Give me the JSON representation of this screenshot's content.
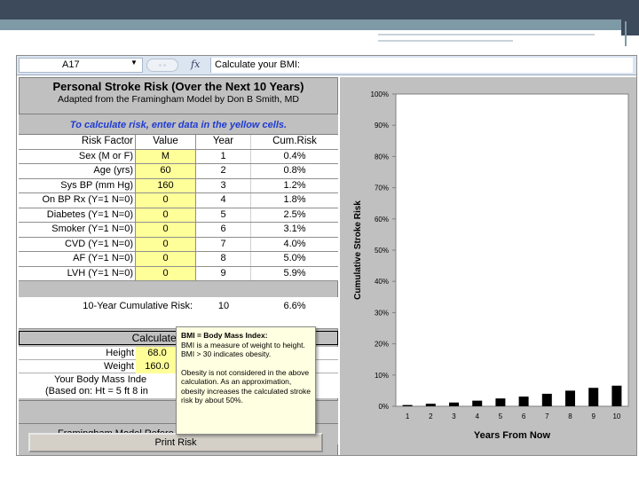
{
  "formula_bar": {
    "cell_ref": "A17",
    "formula": "Calculate your BMI:"
  },
  "sheet": {
    "title": "Personal Stroke Risk (Over the Next 10 Years)",
    "subtitle": "Adapted from the Framingham Model by Don B Smith, MD",
    "instruction": "To calculate risk, enter data in the yellow cells.",
    "columns": [
      "Risk Factor",
      "Value",
      "Year",
      "Cum.Risk"
    ],
    "rows": [
      {
        "factor": "Sex (M or F)",
        "value": "M",
        "year": "1",
        "risk": "0.4%"
      },
      {
        "factor": "Age (yrs)",
        "value": "60",
        "year": "2",
        "risk": "0.8%"
      },
      {
        "factor": "Sys BP (mm Hg)",
        "value": "160",
        "year": "3",
        "risk": "1.2%"
      },
      {
        "factor": "On BP Rx (Y=1 N=0)",
        "value": "0",
        "year": "4",
        "risk": "1.8%"
      },
      {
        "factor": "Diabetes (Y=1 N=0)",
        "value": "0",
        "year": "5",
        "risk": "2.5%"
      },
      {
        "factor": "Smoker (Y=1 N=0)",
        "value": "0",
        "year": "6",
        "risk": "3.1%"
      },
      {
        "factor": "CVD (Y=1 N=0)",
        "value": "0",
        "year": "7",
        "risk": "4.0%"
      },
      {
        "factor": "AF (Y=1 N=0)",
        "value": "0",
        "year": "8",
        "risk": "5.0%"
      },
      {
        "factor": "LVH (Y=1 N=0)",
        "value": "0",
        "year": "9",
        "risk": "5.9%"
      }
    ],
    "cumulative": {
      "label": "10-Year Cumulative Risk:",
      "year": "10",
      "value": "6.6%"
    },
    "bmi_header": "Calculate your BMI:",
    "height_label": "Height",
    "height_value": "68.0",
    "weight_label": "Weight",
    "weight_value": "160.0",
    "your_bmi_line1": "Your Body Mass Inde",
    "your_bmi_line2": "(Based on: Ht = 5 ft 8 in",
    "framingham_ref": "Framingham Model Refere",
    "print_button": "Print Risk"
  },
  "tooltip": {
    "title": "BMI = Body Mass Index:",
    "p1": "BMI is a measure of weight to height. BMI > 30 indicates obesity.",
    "p2": "Obesity is not considered in the above calculation. As an approximation, obesity increases the calculated stroke risk by about 50%."
  },
  "chart_data": {
    "type": "bar",
    "categories": [
      "1",
      "2",
      "3",
      "4",
      "5",
      "6",
      "7",
      "8",
      "9",
      "10"
    ],
    "values": [
      0.4,
      0.8,
      1.2,
      1.8,
      2.5,
      3.1,
      4.0,
      5.0,
      5.9,
      6.6
    ],
    "xlabel": "Years From Now",
    "ylabel": "Cumulative Stroke Risk",
    "ylim": [
      0,
      100
    ],
    "yticks": [
      "0%",
      "10%",
      "20%",
      "30%",
      "40%",
      "50%",
      "60%",
      "70%",
      "80%",
      "90%",
      "100%"
    ],
    "grid": false,
    "bar_color": "#000000"
  }
}
